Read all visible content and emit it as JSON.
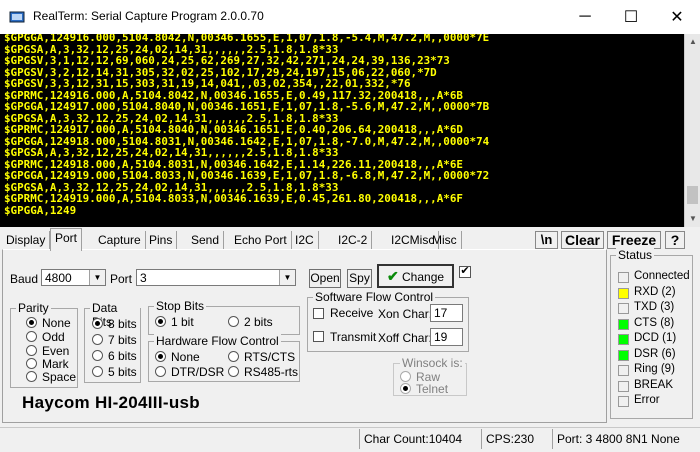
{
  "window": {
    "title": "RealTerm: Serial Capture Program 2.0.0.70",
    "minimize": "─",
    "maximize": "☐",
    "close": "✕"
  },
  "terminal": {
    "lines": [
      "$GPGGA,124916.000,5104.8042,N,00346.1655,E,1,07,1.8,-5.4,M,47.2,M,,0000*7E",
      "$GPGSA,A,3,32,12,25,24,02,14,31,,,,,,2.5,1.8,1.8*33",
      "$GPGSV,3,1,12,12,69,060,24,25,62,269,27,32,42,271,24,24,39,136,23*73",
      "$GPGSV,3,2,12,14,31,305,32,02,25,102,17,29,24,197,15,06,22,060,*7D",
      "$GPGSV,3,3,12,31,15,303,31,19,14,041,,03,02,354,,22,01,332,*76",
      "$GPRMC,124916.000,A,5104.8042,N,00346.1655,E,0.49,117.32,200418,,,A*6B",
      "$GPGGA,124917.000,5104.8040,N,00346.1651,E,1,07,1.8,-5.6,M,47.2,M,,0000*7B",
      "$GPGSA,A,3,32,12,25,24,02,14,31,,,,,,2.5,1.8,1.8*33",
      "$GPRMC,124917.000,A,5104.8040,N,00346.1651,E,0.40,206.64,200418,,,A*6D",
      "$GPGGA,124918.000,5104.8031,N,00346.1642,E,1,07,1.8,-7.0,M,47.2,M,,0000*74",
      "$GPGSA,A,3,32,12,25,24,02,14,31,,,,,,2.5,1.8,1.8*33",
      "$GPRMC,124918.000,A,5104.8031,N,00346.1642,E,1.14,226.11,200418,,,A*6E",
      "$GPGGA,124919.000,5104.8033,N,00346.1639,E,1,07,1.8,-6.8,M,47.2,M,,0000*72",
      "$GPGSA,A,3,32,12,25,24,02,14,31,,,,,,2.5,1.8,1.8*33",
      "$GPRMC,124919.000,A,5104.8033,N,00346.1639,E,0.45,261.80,200418,,,A*6F",
      "$GPGGA,1249"
    ]
  },
  "tabs": [
    "Display",
    "Port",
    "Capture",
    "Pins",
    "Send",
    "Echo Port",
    "I2C",
    "I2C-2",
    "I2CMisc",
    "Misc"
  ],
  "active_tab": "Port",
  "toolbar": {
    "newline": "\\n",
    "clear": "Clear",
    "freeze": "Freeze",
    "help": "?"
  },
  "port": {
    "baud_label": "Baud",
    "baud_value": "4800",
    "port_label": "Port",
    "port_value": "3",
    "open": "Open",
    "spy": "Spy",
    "change": "Change",
    "change_check": "✔",
    "extra_check": "✔"
  },
  "parity": {
    "title": "Parity",
    "options": [
      "None",
      "Odd",
      "Even",
      "Mark",
      "Space"
    ],
    "selected": "None"
  },
  "databits": {
    "title": "Data Bits",
    "options": [
      "8 bits",
      "7 bits",
      "6 bits",
      "5 bits"
    ],
    "selected": "8 bits"
  },
  "stopbits": {
    "title": "Stop Bits",
    "options": [
      "1 bit",
      "2 bits"
    ],
    "selected": "1 bit"
  },
  "hwflow": {
    "title": "Hardware Flow Control",
    "options": [
      "None",
      "RTS/CTS",
      "DTR/DSR",
      "RS485-rts"
    ],
    "selected": "None"
  },
  "swflow": {
    "title": "Software Flow Control",
    "receive": "Receive",
    "transmit": "Transmit",
    "xon_label": "Xon Char:",
    "xon_value": "17",
    "xoff_label": "Xoff Char:",
    "xoff_value": "19"
  },
  "winsock": {
    "title": "Winsock is:",
    "options": [
      "Raw",
      "Telnet"
    ],
    "selected": "Telnet"
  },
  "device_label": "Haycom HI-204III-usb",
  "status": {
    "title": "Status",
    "items": [
      {
        "label": "Connected",
        "color": "#f0f0f0"
      },
      {
        "label": "RXD (2)",
        "color": "#ffff00"
      },
      {
        "label": "TXD (3)",
        "color": "#f0f0f0"
      },
      {
        "label": "CTS (8)",
        "color": "#00ff00"
      },
      {
        "label": "DCD (1)",
        "color": "#00ff00"
      },
      {
        "label": "DSR (6)",
        "color": "#00ff00"
      },
      {
        "label": "Ring (9)",
        "color": "#f0f0f0"
      },
      {
        "label": "BREAK",
        "color": "#f0f0f0"
      },
      {
        "label": "Error",
        "color": "#f0f0f0"
      }
    ]
  },
  "statusbar": {
    "char_count": "Char Count:10404",
    "cps": "CPS:230",
    "port_info": "Port: 3 4800 8N1 None"
  }
}
